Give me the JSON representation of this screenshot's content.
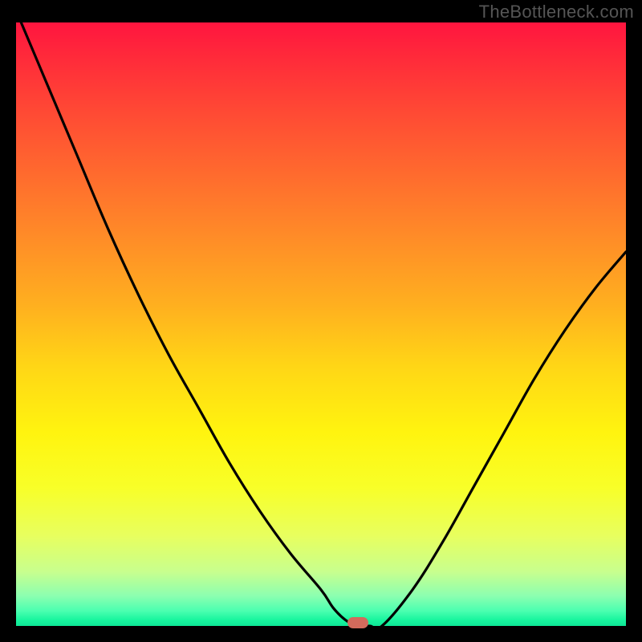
{
  "watermark": "TheBottleneck.com",
  "chart_data": {
    "type": "line",
    "title": "",
    "xlabel": "",
    "ylabel": "",
    "xlim": [
      0,
      100
    ],
    "ylim": [
      0,
      100
    ],
    "grid": false,
    "legend": false,
    "series": [
      {
        "name": "bottleneck-curve",
        "x": [
          0,
          5,
          10,
          15,
          20,
          25,
          30,
          35,
          40,
          45,
          50,
          52,
          54,
          56,
          58,
          60,
          65,
          70,
          75,
          80,
          85,
          90,
          95,
          100
        ],
        "y": [
          102,
          90,
          78,
          66,
          55,
          45,
          36,
          27,
          19,
          12,
          6,
          3,
          1,
          0,
          0,
          0,
          6,
          14,
          23,
          32,
          41,
          49,
          56,
          62
        ]
      }
    ],
    "annotations": [
      {
        "name": "minimum-marker",
        "x": 56,
        "y": 0,
        "shape": "pill",
        "color": "#d26a5c"
      }
    ],
    "background_gradient": {
      "top_color": "#ff153f",
      "mid_color": "#ffd616",
      "bottom_color": "#0ee696"
    }
  },
  "colors": {
    "frame": "#000000",
    "watermark": "#555555",
    "curve": "#000000",
    "marker": "#d26a5c"
  }
}
